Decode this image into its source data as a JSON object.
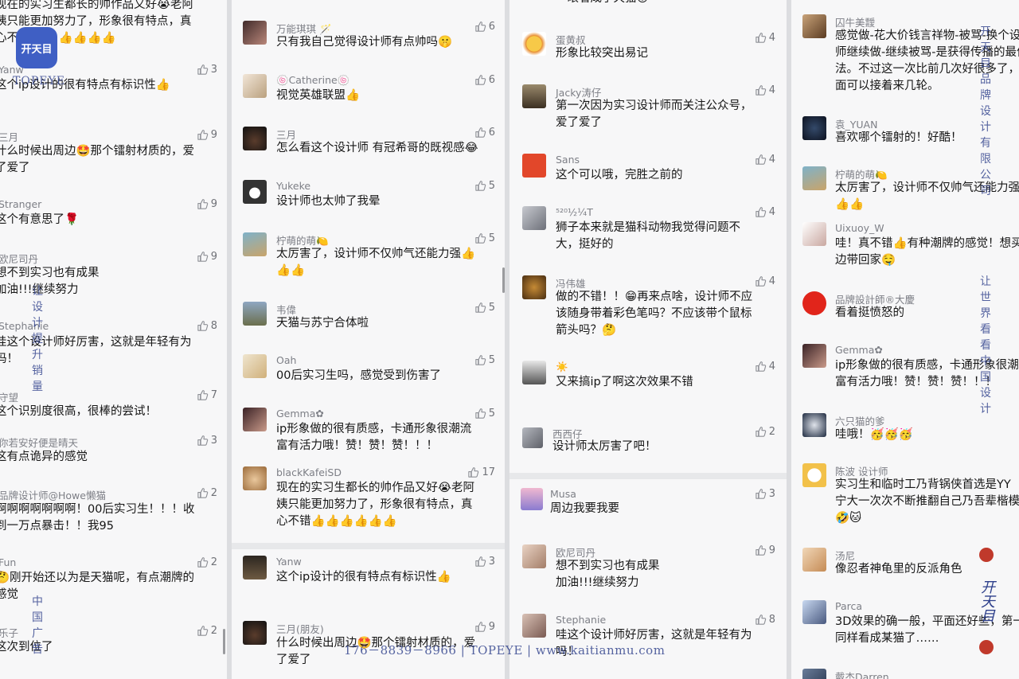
{
  "colors": {
    "like": "#8e9096",
    "text": "#161616",
    "name": "#7d7f86",
    "watermark": "#2c3e8a"
  },
  "watermarks": {
    "logo_text": "开天目",
    "brand": "TOPEYE",
    "vertical_left_1": "让设计提升销量",
    "vertical_left_2": "中国广告",
    "vertical_right_1": "开天目品牌设计有限公司",
    "vertical_right_2": "让世界看看中国设计",
    "stamp_text": "开天目",
    "phone": "176－8839－8966 | TOPEYE | www.kaitianmu.com"
  },
  "col1": [
    {
      "text": "现在的实习生都长的帅作品又好😭老阿\n姨只能更加努力了，形象很有特点，真\n心不错👍👍👍👍👍👍"
    },
    {
      "name": "Yanw",
      "likes": "3",
      "text": "这个ip设计的很有特点有标识性👍"
    },
    {
      "name": "三月",
      "likes": "9",
      "text": "什么时候出周边🤩那个镭射材质的，爱\n了爱了"
    },
    {
      "name": "Stranger",
      "likes": "9",
      "text": "这个有意思了🌹"
    },
    {
      "name": "欧尼司丹",
      "likes": "9",
      "text": "想不到实习也有成果\n加油!!!继续努力"
    },
    {
      "name": "Stephanie",
      "likes": "8",
      "text": "哇这个设计师好厉害，这就是年轻有为\n吗！"
    },
    {
      "name": "守望",
      "likes": "7",
      "text": "这个识别度很高，很棒的尝试！"
    },
    {
      "name": "你若安好便是晴天",
      "likes": "3",
      "text": "这有点诡异的感觉"
    },
    {
      "name": "品牌设计师@Howe懒猫",
      "likes": "2",
      "text": "啊啊啊啊啊啊啊！00后实习生！！！收\n到一万点暴击！！我95"
    },
    {
      "name": "Fun",
      "likes": "2",
      "text": "🤔刚开始还以为是天猫呢，有点潮牌的\n感觉"
    },
    {
      "name": "乐子",
      "likes": "2",
      "text": "这次到位了"
    }
  ],
  "col2": [
    {
      "name": "万能琪琪 🪄",
      "likes": "6",
      "text": "只有我自己觉得设计师有点帅吗🤫"
    },
    {
      "name": "🍥Catherine🍥",
      "likes": "6",
      "text": "视觉英雄联盟👍"
    },
    {
      "name": "三月",
      "likes": "6",
      "text": "怎么看这个设计师 有冠希哥的既视感😂"
    },
    {
      "name": "Yukeke",
      "likes": "5",
      "text": "设计师也太帅了我晕"
    },
    {
      "name": "柠萌的萌🍋",
      "likes": "5",
      "text": "太厉害了，设计师不仅帅气还能力强👍\n👍👍"
    },
    {
      "name": "韦偉",
      "likes": "5",
      "text": "天猫与苏宁合体啦"
    },
    {
      "name": "Oah",
      "likes": "5",
      "text": "00后实习生吗，感觉受到伤害了"
    },
    {
      "name": "Gemma✿",
      "likes": "5",
      "text": "ip形象做的很有质感，卡通形象很潮流\n富有活力哦！赞！赞！赞！！！"
    },
    {
      "name": "blackKafeiSD",
      "likes": "17",
      "text": "现在的实习生都长的帅作品又好😭老阿\n姨只能更加努力了，形象很有特点，真\n心不错👍👍👍👍👍👍"
    },
    {
      "name": "Yanw",
      "likes": "3",
      "text": "这个ip设计的很有特点有标识性👍"
    },
    {
      "name": "三月(朋友)",
      "likes": "9",
      "text": "什么时候出周边🤩那个镭射材质的，爱\n了爱了"
    }
  ],
  "col3": [
    {
      "text": "一眼看成了天猫😮"
    },
    {
      "name": "蛋黄叔",
      "likes": "4",
      "text": "形象比较突出易记"
    },
    {
      "name": "Jacky涛仔",
      "likes": "4",
      "text": "第一次因为实习设计师而关注公众号，\n爱了爱了"
    },
    {
      "name": "Sans",
      "likes": "4",
      "text": "这个可以哦，完胜之前的"
    },
    {
      "name": "⁵²⁰½¼T",
      "likes": "4",
      "text": "狮子本来就是猫科动物我觉得问题不\n大，挺好的"
    },
    {
      "name": "冯伟雄",
      "likes": "4",
      "text": "做的不错！！😁再来点啥，设计师不应\n该随身带着彩色笔吗？不应该带个鼠标\n箭头吗？🤔"
    },
    {
      "name": "☀️",
      "likes": "4",
      "text": "又来搞ip了啊这次效果不错"
    },
    {
      "name": "西西仔",
      "likes": "2",
      "text": "设计师太厉害了吧！"
    },
    {
      "name": "Musa",
      "likes": "3",
      "text": "周边我要我要"
    },
    {
      "name": "欧尼司丹",
      "likes": "9",
      "text": "想不到实习也有成果\n加油!!!继续努力"
    },
    {
      "name": "Stephanie",
      "likes": "8",
      "text": "哇这个设计师好厉害，这就是年轻有为\n吗！"
    }
  ],
  "col4": [
    {
      "name": "囚牛美靉",
      "text": "感觉做-花大价钱言祥物-被骂-换个设计\n师继续做-继续被骂-是获得传播的最佳方\n法。不过这一次比前几次好很多了，后\n面可以接着来几轮。"
    },
    {
      "name": "袁_YUAN",
      "text": "喜欢哪个镭射的！好酷！"
    },
    {
      "name": "柠萌的萌🍋",
      "text": "太厉害了，设计师不仅帅气还能力强👍\n👍👍"
    },
    {
      "name": "Uixuoy_W",
      "text": "哇！真不错👍有种潮牌的感觉！想买周\n边带回家🤤"
    },
    {
      "name": "品牌設計師®大慶",
      "text": "看着挺愤怒的"
    },
    {
      "name": "Gemma✿",
      "text": "ip形象做的很有质感，卡通形象很潮流\n富有活力哦！赞！赞！赞！！！"
    },
    {
      "name": "六只猫的爹",
      "text": "哇哦！🥳🥳🥳"
    },
    {
      "name": "陈波 设计师",
      "text": "实习生和临时工乃背锅侠首选是YY\n宁大一次次不断推翻自己乃吾辈楷模\n🤣🐱"
    },
    {
      "name": "汤尼",
      "text": "像忍者神龟里的反派角色"
    },
    {
      "name": "Parca",
      "text": "3D效果的确一般，平面还好些，第一眼\n同样看成某猫了……"
    },
    {
      "name": "戴杰Darren",
      "text": ""
    }
  ]
}
